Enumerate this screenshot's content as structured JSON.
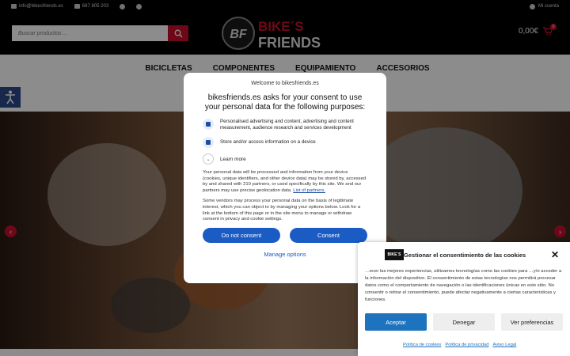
{
  "topbar": {
    "email": "info@bikesfriends.es",
    "phone": "687 805 203",
    "account": "Mi cuenta"
  },
  "header": {
    "search_placeholder": "Buscar productos ...",
    "logo_line1": "BIKE´S",
    "logo_line2": "FRIENDS",
    "logo_mark": "BF",
    "cart_total": "0,00€",
    "cart_count": "0"
  },
  "nav": {
    "items": [
      "BICICLETAS",
      "COMPONENTES",
      "EQUIPAMIENTO",
      "ACCESORIOS"
    ]
  },
  "consent": {
    "top_title": "Welcome to bikesfriends.es",
    "heading": "bikesfriends.es asks for your consent to use your personal data for the following purposes:",
    "purpose1": "Personalised advertising and content, advertising and content measurement, audience research and services development",
    "purpose2": "Store and/or access information on a device",
    "learn_more": "Learn more",
    "para1": "Your personal data will be processed and information from your device (cookies, unique identifiers, and other device data) may be stored by, accessed by and shared with 210 partners, or used specifically by this site. We and our partners may use precise geolocation data.",
    "partners_link": "List of partners.",
    "para2": "Some vendors may process your personal data on the basis of legitimate interest, which you can object to by managing your options below. Look for a link at the bottom of this page or in the site menu to manage or withdraw consent in privacy and cookie settings.",
    "do_not_consent": "Do not consent",
    "consent": "Consent",
    "manage_options": "Manage options"
  },
  "cookie_panel": {
    "title": "Gestionar el consentimiento de las cookies",
    "body": "…ecer las mejores experiencias, utilizamos tecnologías como las cookies para …y/o acceder a la información del dispositivo. El consentimiento de estas tecnologías nos permitirá procesar datos como el comportamiento de navegación o las identificaciones únicas en este sitio. No consentir o retirar el consentimiento, puede afectar negativamente a ciertas características y funciones.",
    "accept": "Aceptar",
    "deny": "Denegar",
    "preferences": "Ver preferencias",
    "link_cookies": "Política de cookies",
    "link_privacy": "Política de privacidad",
    "link_legal": "Aviso Legal"
  },
  "colors": {
    "brand_red": "#c8102e",
    "consent_blue": "#1a5bc4",
    "accept_blue": "#1e73be"
  }
}
